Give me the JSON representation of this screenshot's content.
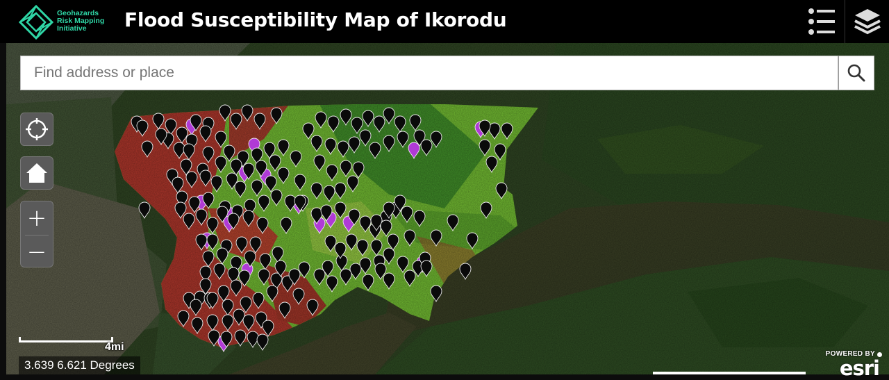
{
  "header": {
    "org_name_lines": [
      "Geohazards",
      "Risk Mapping",
      "Initiative"
    ],
    "title": "Flood Susceptibility Map of Ikorodu",
    "legend_icon": "list-icon",
    "layers_icon": "layers-icon"
  },
  "search": {
    "placeholder": "Find address or place",
    "value": "",
    "icon": "search-icon"
  },
  "map_controls": {
    "locate_icon": "crosshair-icon",
    "home_icon": "home-icon",
    "zoom_in": "+",
    "zoom_out": "−"
  },
  "scale": {
    "label": "4mi"
  },
  "coordinates": {
    "text": "3.639 6.621 Degrees"
  },
  "esri": {
    "powered_by": "POWERED BY",
    "brand": "esri"
  },
  "colors": {
    "header_bg": "#000000",
    "accent_teal": "#2fd6a6",
    "high_susceptibility": "#a8352a",
    "low_susceptibility": "#6fb631",
    "marker_black": "#0a0a0a",
    "marker_purple": "#b03ad6"
  }
}
